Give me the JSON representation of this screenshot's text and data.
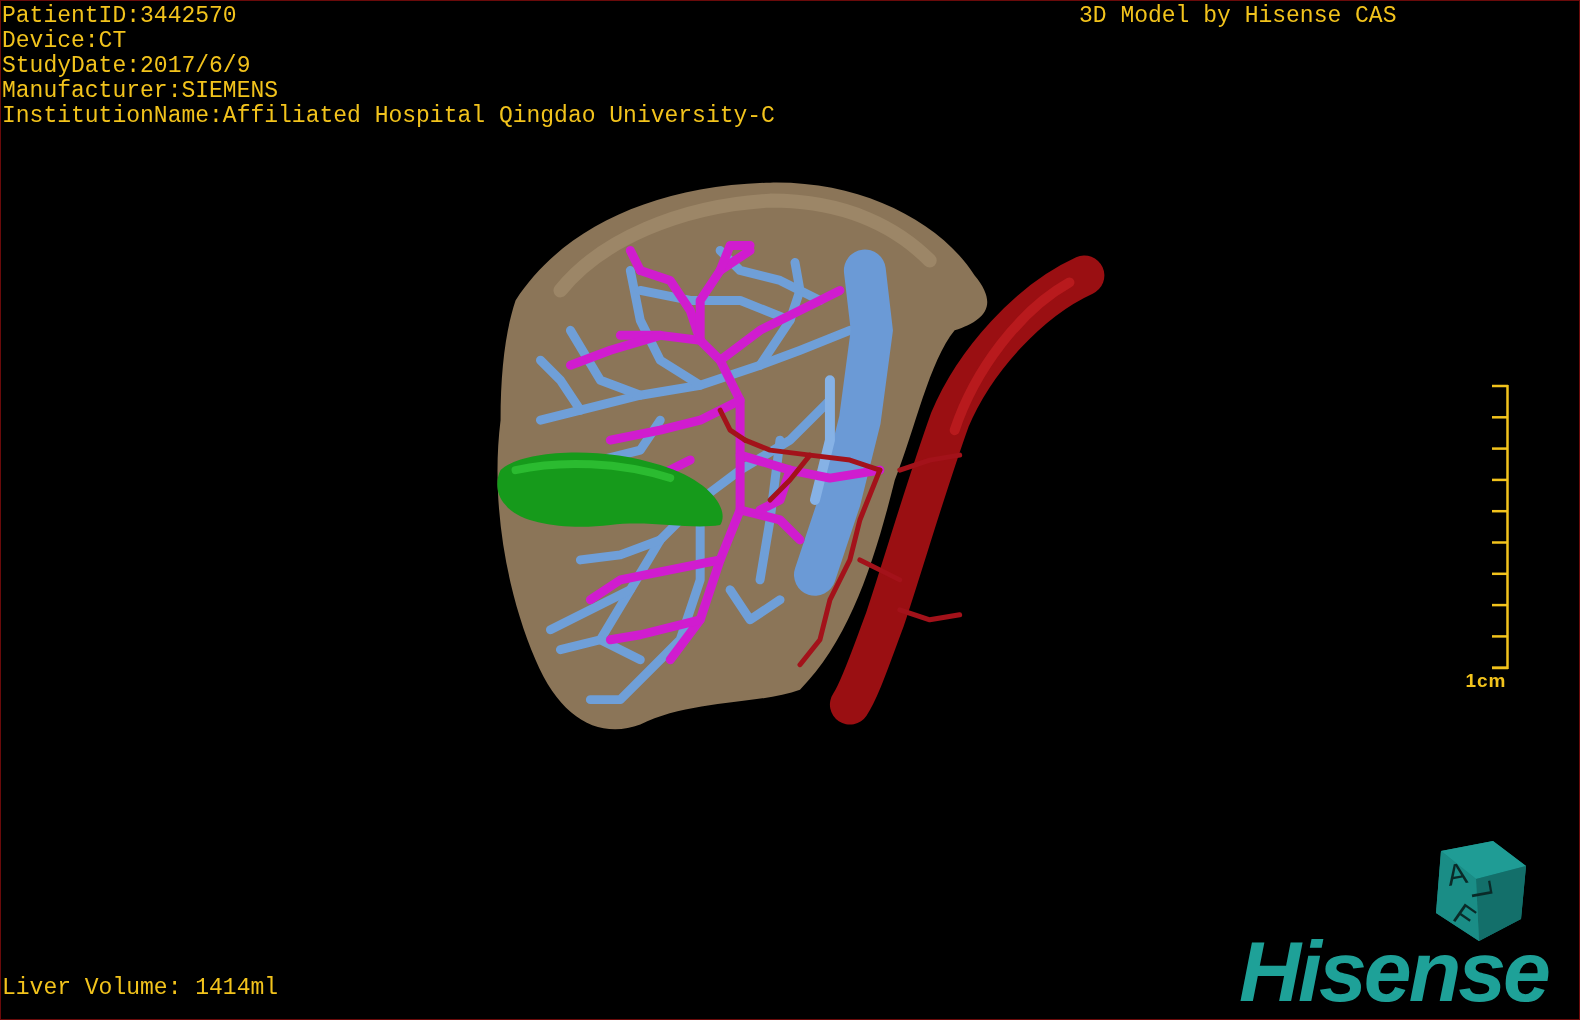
{
  "patient_info": [
    "PatientID:3442570",
    "Device:CT",
    "StudyDate:2017/6/9",
    "Manufacturer:SIEMENS",
    "InstitutionName:Affiliated Hospital Qingdao University-C"
  ],
  "model_caption": "3D Model by Hisense CAS",
  "scale_bar": {
    "label": "1cm"
  },
  "orientation_cube": {
    "labels": [
      "A",
      "L",
      "F"
    ]
  },
  "liver_volume": "Liver Volume: 1414ml",
  "logo": "Hisense"
}
